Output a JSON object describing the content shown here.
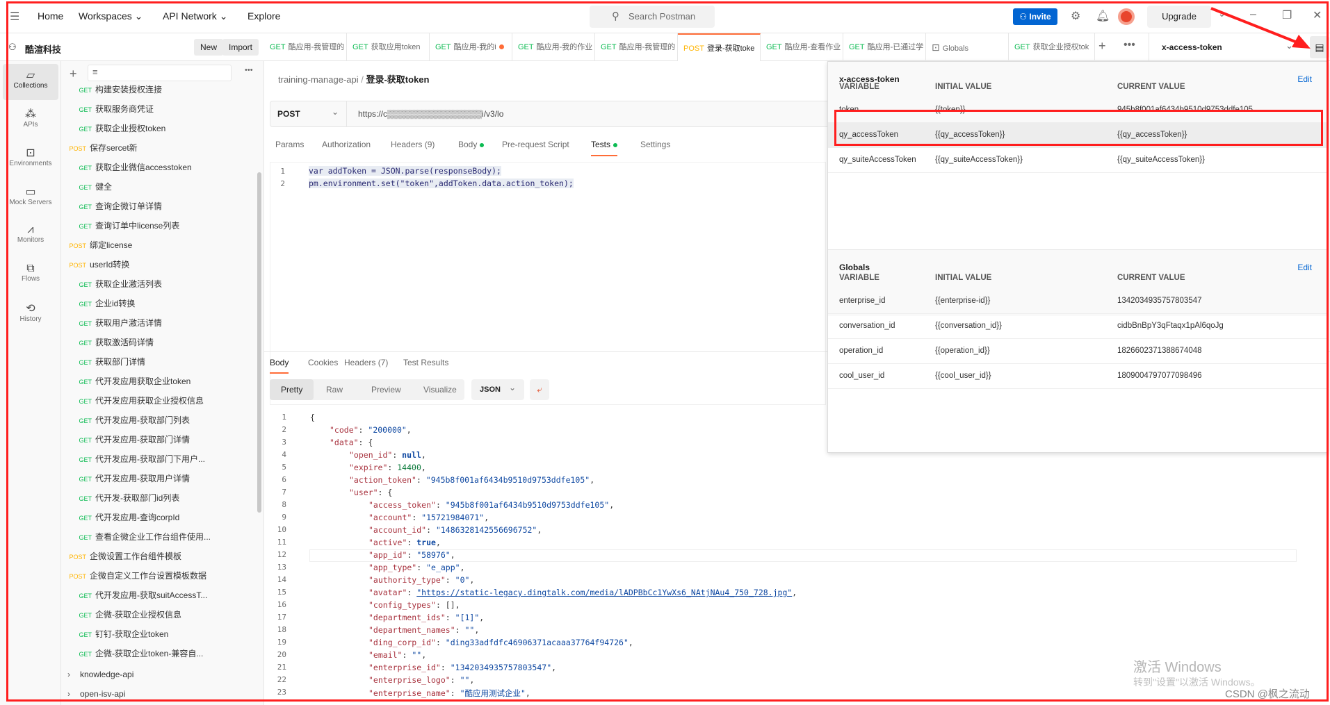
{
  "topbar": {
    "menu_icon": "hamburger-icon",
    "home": "Home",
    "workspaces": "Workspaces",
    "api_network": "API Network",
    "explore": "Explore",
    "search_placeholder": "Search Postman",
    "invite": "Invite",
    "upgrade": "Upgrade"
  },
  "workspace": {
    "name": "酷渲科技",
    "new": "New",
    "import": "Import"
  },
  "tabs": [
    {
      "method": "GET",
      "label": "酷应用-我管理的"
    },
    {
      "method": "GET",
      "label": "获取应用token"
    },
    {
      "method": "GET",
      "label": "酷应用-我的i",
      "dot": true
    },
    {
      "method": "GET",
      "label": "酷应用-我的作业"
    },
    {
      "method": "GET",
      "label": "酷应用-我管理的"
    },
    {
      "method": "POST",
      "label": "登录-获取toke",
      "active": true
    },
    {
      "method": "GET",
      "label": "酷应用-查看作业"
    },
    {
      "method": "GET",
      "label": "酷应用-已通过学"
    },
    {
      "method": "",
      "label": "Globals"
    },
    {
      "method": "GET",
      "label": "获取企业授权tok"
    }
  ],
  "environment": {
    "selected": "x-access-token"
  },
  "iconnav": [
    {
      "label": "Collections",
      "icon": "collections-icon",
      "active": true
    },
    {
      "label": "APIs",
      "icon": "apis-icon"
    },
    {
      "label": "Environments",
      "icon": "environments-icon"
    },
    {
      "label": "Mock Servers",
      "icon": "mock-servers-icon"
    },
    {
      "label": "Monitors",
      "icon": "monitors-icon"
    },
    {
      "label": "Flows",
      "icon": "flows-icon"
    },
    {
      "label": "History",
      "icon": "history-icon"
    }
  ],
  "sidebar": {
    "items": [
      {
        "m": "GET",
        "t": "构建安装授权连接"
      },
      {
        "m": "GET",
        "t": "获取服务商凭证"
      },
      {
        "m": "GET",
        "t": "获取企业授权token"
      },
      {
        "m": "POST",
        "t": "保存sercet新"
      },
      {
        "m": "GET",
        "t": "获取企业微信accesstoken"
      },
      {
        "m": "GET",
        "t": "健全"
      },
      {
        "m": "GET",
        "t": "查询企微订单详情"
      },
      {
        "m": "GET",
        "t": "查询订单中license列表"
      },
      {
        "m": "POST",
        "t": "绑定license"
      },
      {
        "m": "POST",
        "t": "userId转换"
      },
      {
        "m": "GET",
        "t": "获取企业激活列表"
      },
      {
        "m": "GET",
        "t": "企业id转换"
      },
      {
        "m": "GET",
        "t": "获取用户激活详情"
      },
      {
        "m": "GET",
        "t": "获取激活码详情"
      },
      {
        "m": "GET",
        "t": "获取部门详情"
      },
      {
        "m": "GET",
        "t": "代开发应用获取企业token"
      },
      {
        "m": "GET",
        "t": "代开发应用获取企业授权信息"
      },
      {
        "m": "GET",
        "t": "代开发应用-获取部门列表"
      },
      {
        "m": "GET",
        "t": "代开发应用-获取部门详情"
      },
      {
        "m": "GET",
        "t": "代开发应用-获取部门下用户..."
      },
      {
        "m": "GET",
        "t": "代开发应用-获取用户详情"
      },
      {
        "m": "GET",
        "t": "代开发-获取部门id列表"
      },
      {
        "m": "GET",
        "t": "代开发应用-查询corpId"
      },
      {
        "m": "GET",
        "t": "查看企微企业工作台组件使用..."
      },
      {
        "m": "POST",
        "t": "企微设置工作台组件模板"
      },
      {
        "m": "POST",
        "t": "企微自定义工作台设置模板数据"
      },
      {
        "m": "GET",
        "t": "代开发应用-获取suitAccessT..."
      },
      {
        "m": "GET",
        "t": "企微-获取企业授权信息"
      },
      {
        "m": "GET",
        "t": "钉钉-获取企业token"
      },
      {
        "m": "GET",
        "t": "企微-获取企业token-兼容自..."
      }
    ],
    "folders": [
      "knowledge-api",
      "open-isv-api"
    ]
  },
  "request": {
    "breadcrumb_parent": "training-manage-api",
    "breadcrumb_current": "登录-获取token",
    "method": "POST",
    "url": "https://c▒▒▒▒▒▒▒▒▒▒▒▒▒▒▒▒i/v3/lo",
    "tabs": [
      "Params",
      "Authorization",
      "Headers (9)",
      "Body",
      "Pre-request Script",
      "Tests",
      "Settings"
    ],
    "active_tab": "Tests",
    "script": [
      "var addToken = JSON.parse(responseBody);",
      "pm.environment.set(\"token\",addToken.data.action_token);"
    ]
  },
  "response": {
    "tabs": [
      "Body",
      "Cookies",
      "Headers (7)",
      "Test Results"
    ],
    "views": [
      "Pretty",
      "Raw",
      "Preview",
      "Visualize"
    ],
    "format": "JSON",
    "lines": [
      [
        "",
        "{"
      ],
      [
        "code",
        "\"200000\"",
        1
      ],
      [
        "data",
        "{",
        1
      ],
      [
        "open_id",
        "null",
        2
      ],
      [
        "expire",
        "14400",
        2
      ],
      [
        "action_token",
        "\"945b8f001af6434b9510d9753ddfe105\"",
        2
      ],
      [
        "user",
        "{",
        2
      ],
      [
        "access_token",
        "\"945b8f001af6434b9510d9753ddfe105\"",
        3
      ],
      [
        "account",
        "\"15721984071\"",
        3
      ],
      [
        "account_id",
        "\"1486328142556696752\"",
        3
      ],
      [
        "active",
        "true",
        3
      ],
      [
        "app_id",
        "\"58976\"",
        3
      ],
      [
        "app_type",
        "\"e_app\"",
        3
      ],
      [
        "authority_type",
        "\"0\"",
        3
      ],
      [
        "avatar",
        "\"https://static-legacy.dingtalk.com/media/lADPBbCc1YwXs6_NAtjNAu4_750_728.jpg\"",
        3
      ],
      [
        "config_types",
        "[]",
        3
      ],
      [
        "department_ids",
        "\"[1]\"",
        3
      ],
      [
        "department_names",
        "\"\"",
        3
      ],
      [
        "ding_corp_id",
        "\"ding33adfdfc46906371acaaa37764f94726\"",
        3
      ],
      [
        "email",
        "\"\"",
        3
      ],
      [
        "enterprise_id",
        "\"1342034935757803547\"",
        3
      ],
      [
        "enterprise_logo",
        "\"\"",
        3
      ],
      [
        "enterprise_name",
        "\"酷应用测试企业\"",
        3
      ]
    ]
  },
  "env_panel": {
    "title": "x-access-token",
    "edit": "Edit",
    "headers": [
      "VARIABLE",
      "INITIAL VALUE",
      "CURRENT VALUE"
    ],
    "rows": [
      [
        "token",
        "{{token}}",
        "945b8f001af6434b9510d9753ddfe105"
      ],
      [
        "qy_accessToken",
        "{{qy_accessToken}}",
        "{{qy_accessToken}}"
      ],
      [
        "qy_suiteAccessToken",
        "{{qy_suiteAccessToken}}",
        "{{qy_suiteAccessToken}}"
      ]
    ],
    "globals_title": "Globals",
    "globals_edit": "Edit",
    "globals": [
      [
        "enterprise_id",
        "{{enterprise-id}}",
        "1342034935757803547"
      ],
      [
        "conversation_id",
        "{{conversation_id}}",
        "cidbBnBpY3qFtaqx1pAl6qoJg"
      ],
      [
        "operation_id",
        "{{operation_id}}",
        "1826602371388674048"
      ],
      [
        "cool_user_id",
        "{{cool_user_id}}",
        "1809004797077098496"
      ]
    ]
  },
  "watermark": {
    "line1": "激活 Windows",
    "line2": "转到\"设置\"以激活 Windows。",
    "credit": "CSDN @枫之流动"
  },
  "colors": {
    "accent": "#ff6c37",
    "get": "#0cbb52",
    "post": "#ffb400",
    "invite": "#0265d2",
    "annotation": "#ff1e1e"
  }
}
